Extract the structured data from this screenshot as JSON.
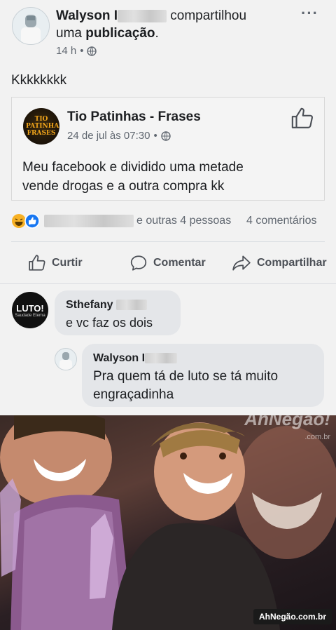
{
  "share_post": {
    "author_first": "Walyson",
    "author_initial": "I",
    "action": "compartilhou",
    "action_line2_prefix": "uma",
    "action_line2_bold": "publicação",
    "action_line2_suffix": ".",
    "time": "14 h",
    "menu": "···",
    "caption": "Kkkkkkkk"
  },
  "original_post": {
    "page_name": "Tio Patinhas - Frases",
    "avatar_text": "TIO PATINHAS FRASES",
    "date": "24 de jul às 07:30",
    "text_line1": "Meu facebook e dividido uma metade",
    "text_line2": "vende drogas e a outra compra kk"
  },
  "reactions": {
    "others": "e outras 4 pessoas",
    "comments": "4 comentários"
  },
  "actions": {
    "like": "Curtir",
    "comment": "Comentar",
    "share": "Compartilhar"
  },
  "comments": [
    {
      "author": "Sthefany",
      "avatar_text": "LUTO!",
      "avatar_sub": "Saudade Eterna",
      "text": "e vc faz os dois"
    },
    {
      "author": "Walyson I",
      "text_line1": "Pra quem tá de luto se tá muito",
      "text_line2": "engraçadinha"
    }
  ],
  "watermark": {
    "logo": "AhNegão!",
    "logo_sub": ".com.br",
    "footer": "AhNegão.com.br"
  },
  "colors": {
    "accent": "#385898",
    "like_blue": "#1877f2",
    "haha_yellow": "#f7b125"
  }
}
